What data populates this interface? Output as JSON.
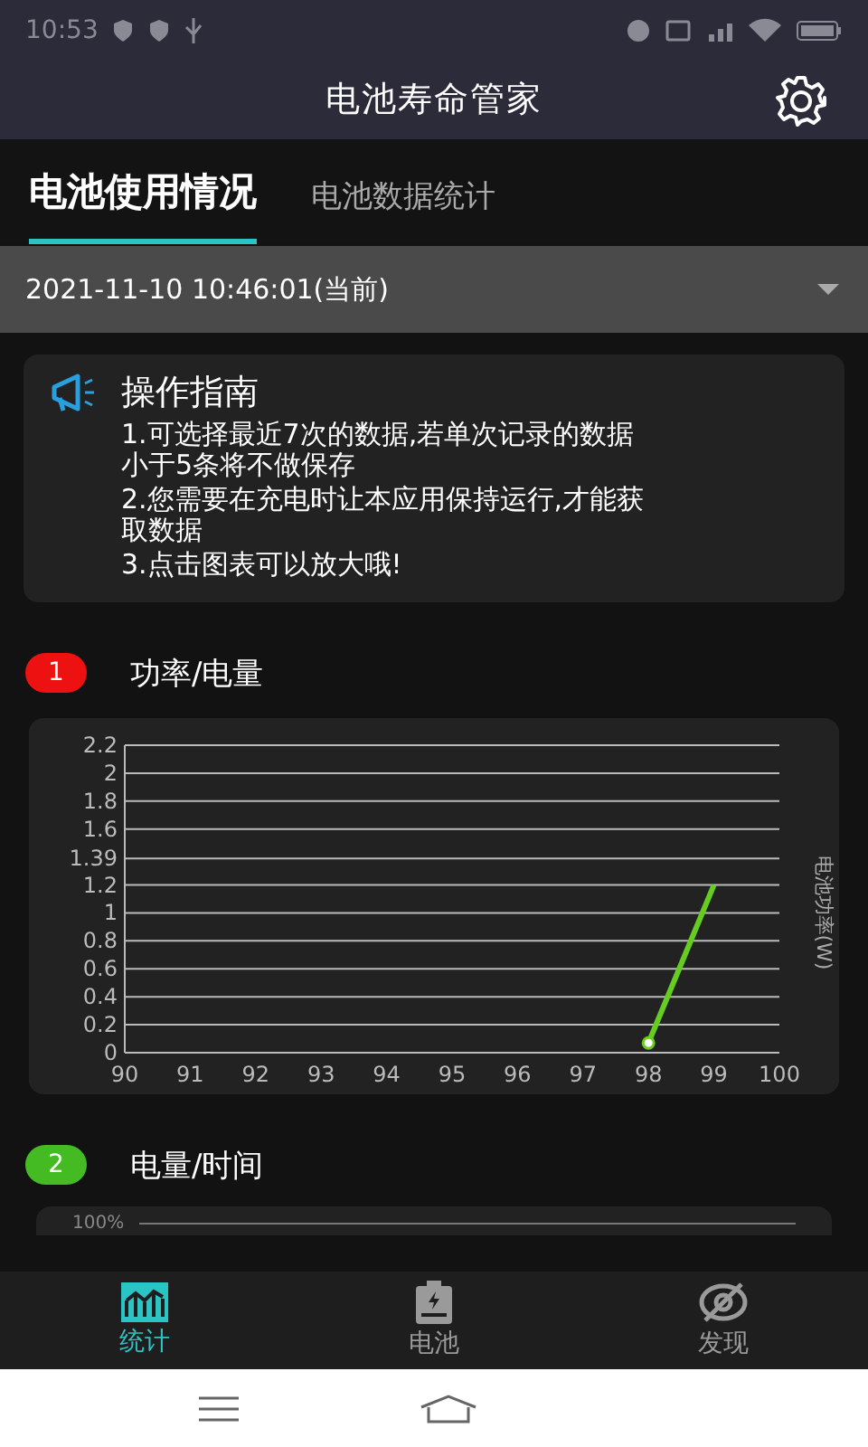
{
  "status_bar": {
    "time": "10:53"
  },
  "app_bar": {
    "title": "电池寿命管家"
  },
  "tabs": [
    {
      "label": "电池使用情况",
      "selected": true
    },
    {
      "label": "电池数据统计",
      "selected": false
    }
  ],
  "record_select": {
    "value": "2021-11-10 10:46:01(当前)"
  },
  "guide": {
    "title": "操作指南",
    "lines": [
      "1.可选择最近7次的数据,若单次记录的数据小于5条将不做保存",
      "2.您需要在充电时让本应用保持运行,才能获取数据",
      "3.点击图表可以放大哦!"
    ]
  },
  "sections": [
    {
      "number": "1",
      "color": "#ee1111",
      "title": "功率/电量",
      "chart_data": {
        "type": "line",
        "ylabel": "电池功率(W)",
        "x": [
          98,
          99
        ],
        "grid": true,
        "series": [
          {
            "color": "#66cc22",
            "values": [
              0.07,
              1.2
            ]
          }
        ],
        "xlim": [
          90,
          100
        ],
        "ylim": [
          0,
          2.2
        ],
        "xticks": [
          90,
          91,
          92,
          93,
          94,
          95,
          96,
          97,
          98,
          99,
          100
        ],
        "yticks": [
          0,
          0.2,
          0.4,
          0.6,
          0.8,
          1,
          1.2,
          1.39,
          1.6,
          1.8,
          2,
          2.2
        ]
      }
    },
    {
      "number": "2",
      "color": "#44bb22",
      "title": "电量/时间",
      "chart_top_label": "100%"
    }
  ],
  "bottom_nav": [
    {
      "label": "统计",
      "selected": true
    },
    {
      "label": "电池",
      "selected": false
    },
    {
      "label": "发现",
      "selected": false
    }
  ]
}
